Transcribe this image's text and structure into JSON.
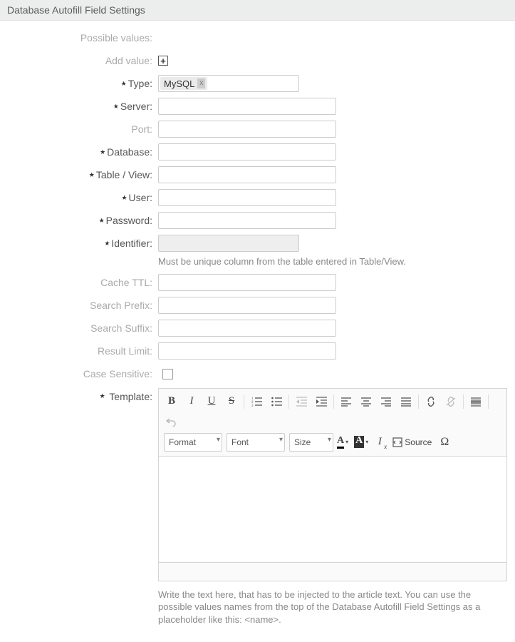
{
  "header": {
    "title": "Database Autofill Field Settings"
  },
  "labels": {
    "possible_values": "Possible values:",
    "add_value": "Add value:",
    "type": "Type:",
    "server": "Server:",
    "port": "Port:",
    "database": "Database:",
    "table_view": "Table / View:",
    "user": "User:",
    "password": "Password:",
    "identifier": "Identifier:",
    "cache_ttl": "Cache TTL:",
    "search_prefix": "Search Prefix:",
    "search_suffix": "Search Suffix:",
    "result_limit": "Result Limit:",
    "case_sensitive": "Case Sensitive:",
    "template": "Template:"
  },
  "values": {
    "type_chip": "MySQL",
    "server": "",
    "port": "",
    "database": "",
    "table_view": "",
    "user": "",
    "password": "",
    "identifier": "",
    "cache_ttl": "",
    "search_prefix": "",
    "search_suffix": "",
    "result_limit": "",
    "case_sensitive": false
  },
  "hints": {
    "identifier": "Must be unique column from the table entered in Table/View.",
    "template": "Write the text here, that has to be injected to the article text. You can use the possible values names from the top of the Database Autofill Field Settings as a placeholder like this: <name>."
  },
  "toolbar": {
    "format": "Format",
    "font": "Font",
    "size": "Size",
    "source": "Source"
  }
}
